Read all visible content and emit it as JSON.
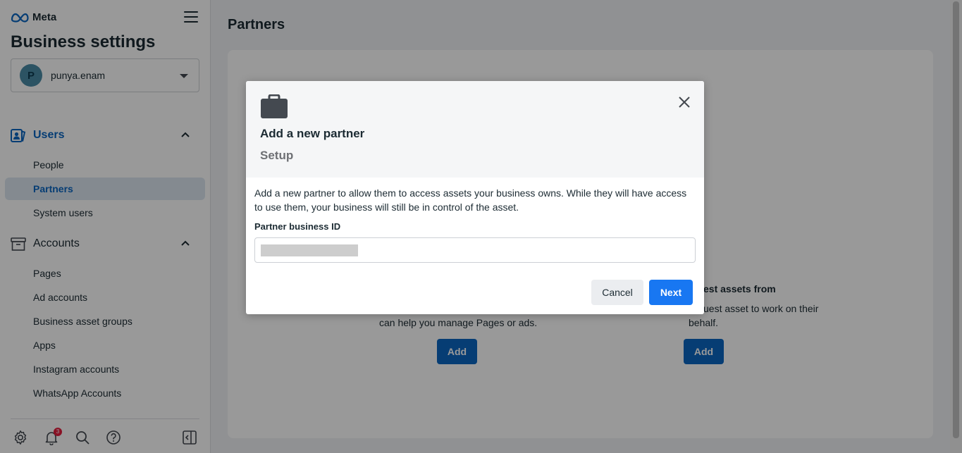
{
  "brand": {
    "name": "Meta"
  },
  "sidebar": {
    "title": "Business settings",
    "account": {
      "initial": "P",
      "name": "punya.enam"
    },
    "sections": [
      {
        "label": "Users",
        "items": [
          "People",
          "Partners",
          "System users"
        ]
      },
      {
        "label": "Accounts",
        "items": [
          "Pages",
          "Ad accounts",
          "Business asset groups",
          "Apps",
          "Instagram accounts",
          "WhatsApp Accounts"
        ]
      }
    ],
    "active_item": "Partners",
    "footer": {
      "notification_count": "3"
    }
  },
  "main": {
    "title": "Partners",
    "background": {
      "left_text": "can help you manage Pages or ads.",
      "right_heading": "est assets from",
      "right_text_line1": "uest asset to work on their",
      "right_text_line2": "behalf.",
      "add_label": "Add"
    }
  },
  "modal": {
    "title": "Add a new partner",
    "subtitle": "Setup",
    "description": "Add a new partner to allow them to access assets your business owns. While they will have access to use them, your business will still be in control of the asset.",
    "field_label": "Partner business ID",
    "cancel_label": "Cancel",
    "next_label": "Next"
  },
  "colors": {
    "accent": "#0a66c2",
    "primary_button": "#1877f2",
    "badge": "#e41e3f"
  }
}
